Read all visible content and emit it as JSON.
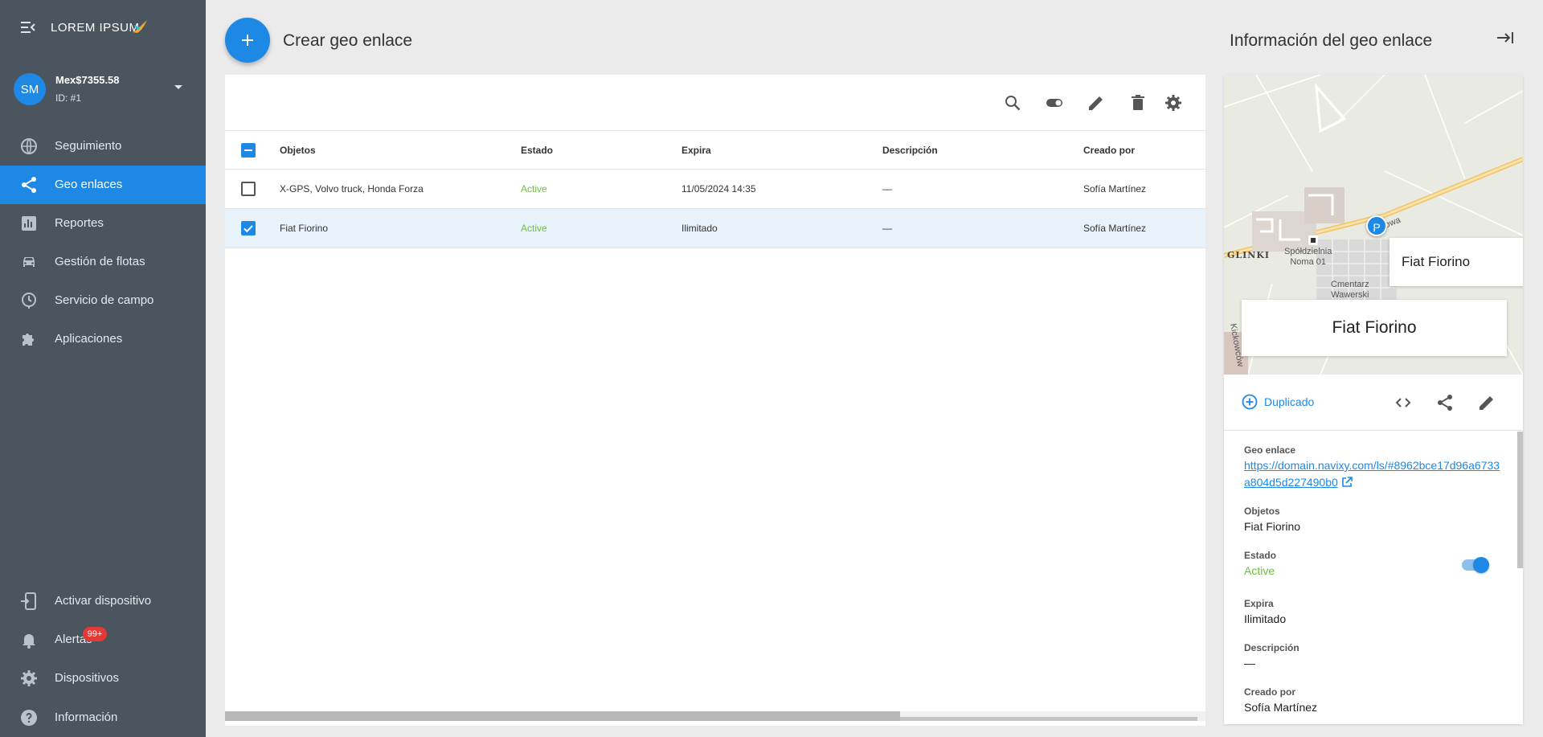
{
  "app": {
    "brand": "LOREM IPSUM"
  },
  "account": {
    "initials": "SM",
    "balance": "Mex$7355.58",
    "id": "ID: #1"
  },
  "nav": {
    "items": [
      {
        "label": "Seguimiento",
        "icon": "globe-icon"
      },
      {
        "label": "Geo enlaces",
        "icon": "share-icon",
        "active": true
      },
      {
        "label": "Reportes",
        "icon": "report-icon"
      },
      {
        "label": "Gestión de flotas",
        "icon": "car-icon"
      },
      {
        "label": "Servicio de campo",
        "icon": "clock-icon"
      },
      {
        "label": "Aplicaciones",
        "icon": "puzzle-icon"
      }
    ],
    "bottom": [
      {
        "label": "Activar dispositivo",
        "icon": "device-add-icon"
      },
      {
        "label": "Alertas",
        "icon": "bell-icon",
        "badge": "99+"
      },
      {
        "label": "Dispositivos",
        "icon": "gear-icon"
      },
      {
        "label": "Información",
        "icon": "help-icon"
      }
    ]
  },
  "header": {
    "create_label": "Crear geo enlace",
    "info_title": "Información del geo enlace"
  },
  "table": {
    "columns": [
      "Objetos",
      "Estado",
      "Expira",
      "Descripción",
      "Creado por"
    ],
    "rows": [
      {
        "objects": "X-GPS, Volvo truck, Honda Forza",
        "status": "Active",
        "expires": "11/05/2024 14:35",
        "description": "—",
        "created_by": "Sofía Martínez",
        "checked": false
      },
      {
        "objects": "Fiat Fiorino",
        "status": "Active",
        "expires": "Ilimitado",
        "description": "—",
        "created_by": "Sofía Martínez",
        "checked": true
      }
    ]
  },
  "map": {
    "labels": {
      "district": "GLINKI",
      "coop": "Spółdzielnia\nNoma 01",
      "cemetery": "Cmentarz\nWawerski",
      "road_right": "owa",
      "road_left": "Kickowców"
    },
    "pin": "P",
    "card_small": "Fiat Fiorino",
    "card_big": "Fiat Fiorino"
  },
  "info": {
    "duplicate_label": "Duplicado",
    "geo_link_label": "Geo enlace",
    "geo_link": "https://domain.navixy.com/ls/#8962bce17d96a6733a804d5d227490b0",
    "objects_label": "Objetos",
    "objects": "Fiat Fiorino",
    "status_label": "Estado",
    "status": "Active",
    "status_on": true,
    "expires_label": "Expira",
    "expires": "Ilimitado",
    "description_label": "Descripción",
    "description": "—",
    "created_label": "Creado por",
    "created_by": "Sofía Martínez"
  },
  "colors": {
    "sidebar": "#4a5560",
    "accent": "#1e88e5",
    "status_active": "#6cbf3c",
    "badge": "#e53935"
  }
}
